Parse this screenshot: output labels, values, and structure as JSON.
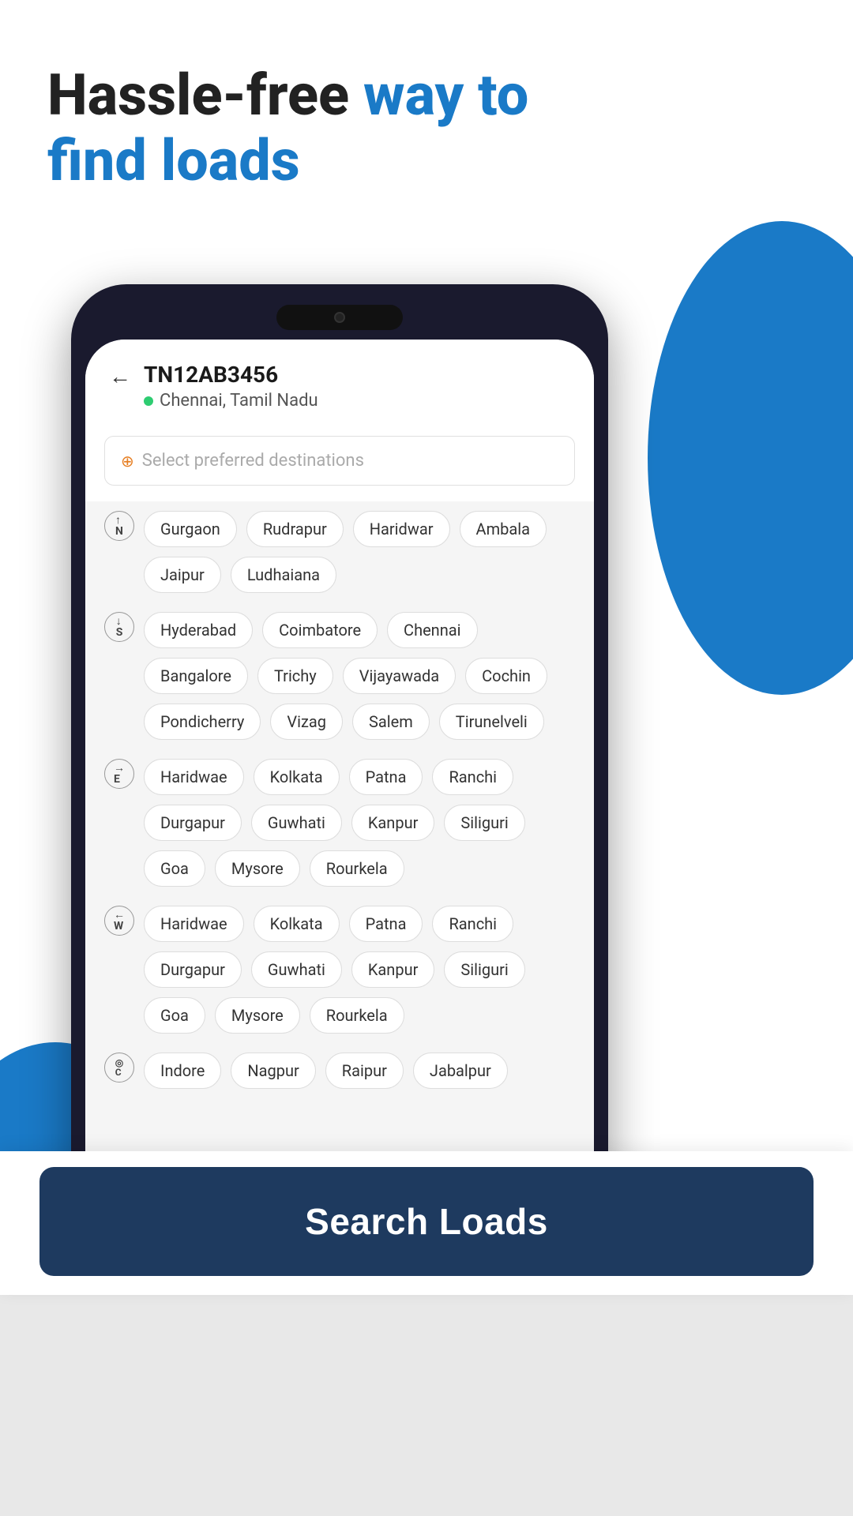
{
  "headline": {
    "part1": "Hassle-free ",
    "part2": "way to find loads"
  },
  "vehicle": {
    "id": "TN12AB3456",
    "location": "Chennai, Tamil Nadu"
  },
  "search": {
    "placeholder": "Select preferred destinations"
  },
  "directions": {
    "north": {
      "label": "N",
      "arrow": "↑",
      "tags": [
        "Gurgaon",
        "Rudrapur",
        "Haridwar",
        "Ambala",
        "Jaipur",
        "Ludhaiana"
      ]
    },
    "south": {
      "label": "S",
      "arrow": "↓",
      "tags": [
        "Hyderabad",
        "Coimbatore",
        "Chennai",
        "Bangalore",
        "Trichy",
        "Vijayawada",
        "Cochin",
        "Pondicherry",
        "Vizag",
        "Salem",
        "Tirunelveli"
      ]
    },
    "east": {
      "label": "E",
      "arrow": "→",
      "tags": [
        "Haridwae",
        "Kolkata",
        "Patna",
        "Ranchi",
        "Durgapur",
        "Guwhati",
        "Kanpur",
        "Siliguri",
        "Goa",
        "Mysore",
        "Rourkela"
      ]
    },
    "west": {
      "label": "W",
      "arrow": "←",
      "tags": [
        "Haridwae",
        "Kolkata",
        "Patna",
        "Ranchi",
        "Durgapur",
        "Guwhati",
        "Kanpur",
        "Siliguri",
        "Goa",
        "Mysore",
        "Rourkela"
      ]
    },
    "central": {
      "label": "C",
      "arrow": "◎",
      "tags": [
        "Indore",
        "Nagpur",
        "Raipur",
        "Jabalpur"
      ]
    }
  },
  "button": {
    "search_loads": "Search Loads"
  },
  "colors": {
    "accent_blue": "#1a7ac7",
    "dark_navy": "#1e3a5f"
  }
}
